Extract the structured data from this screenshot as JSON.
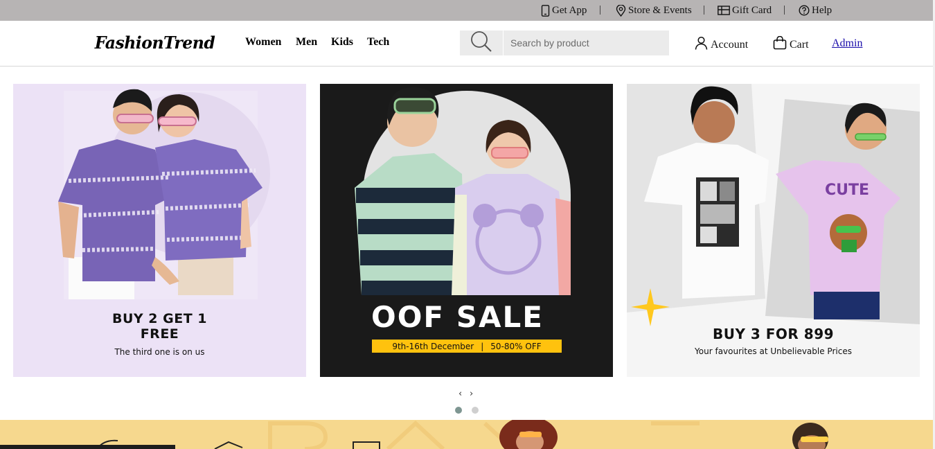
{
  "utility_bar": {
    "items": [
      {
        "label": "Get App",
        "icon": "phone-icon"
      },
      {
        "label": "Store & Events",
        "icon": "location-pin-icon"
      },
      {
        "label": "Gift Card",
        "icon": "gift-card-icon"
      },
      {
        "label": "Help",
        "icon": "help-circle-icon"
      }
    ],
    "separator": "|"
  },
  "header": {
    "logo": "FashionTrend",
    "nav": [
      "Women",
      "Men",
      "Kids",
      "Tech"
    ],
    "search": {
      "placeholder": "Search by product",
      "value": "",
      "icon": "search-icon"
    },
    "account_label": "Account",
    "cart_label": "Cart",
    "admin_label": "Admin"
  },
  "banners": [
    {
      "title_line1": "BUY 2 GET 1",
      "title_line2": "FREE",
      "subtitle": "The third one is on us",
      "background": "#ece2f6"
    },
    {
      "title": "OOF SALE",
      "date_text": "9th-16th December",
      "divider": "|",
      "offer": "50-80% OFF",
      "background": "#1a1a1a",
      "accent": "#ffc20e"
    },
    {
      "title": "BUY 3 FOR 899",
      "subtitle": "Your favourites at Unbelievable Prices",
      "background": "#f5f5f5"
    }
  ],
  "carousel": {
    "prev": "‹",
    "next": "›",
    "pages": 2,
    "active_page": 1
  },
  "colors": {
    "utility_bar": "#b7b4b4",
    "search_bg": "#ebebeb",
    "link": "#1a0dab",
    "promo_strip": "#f6d88e",
    "dot_active": "#7e9692"
  }
}
